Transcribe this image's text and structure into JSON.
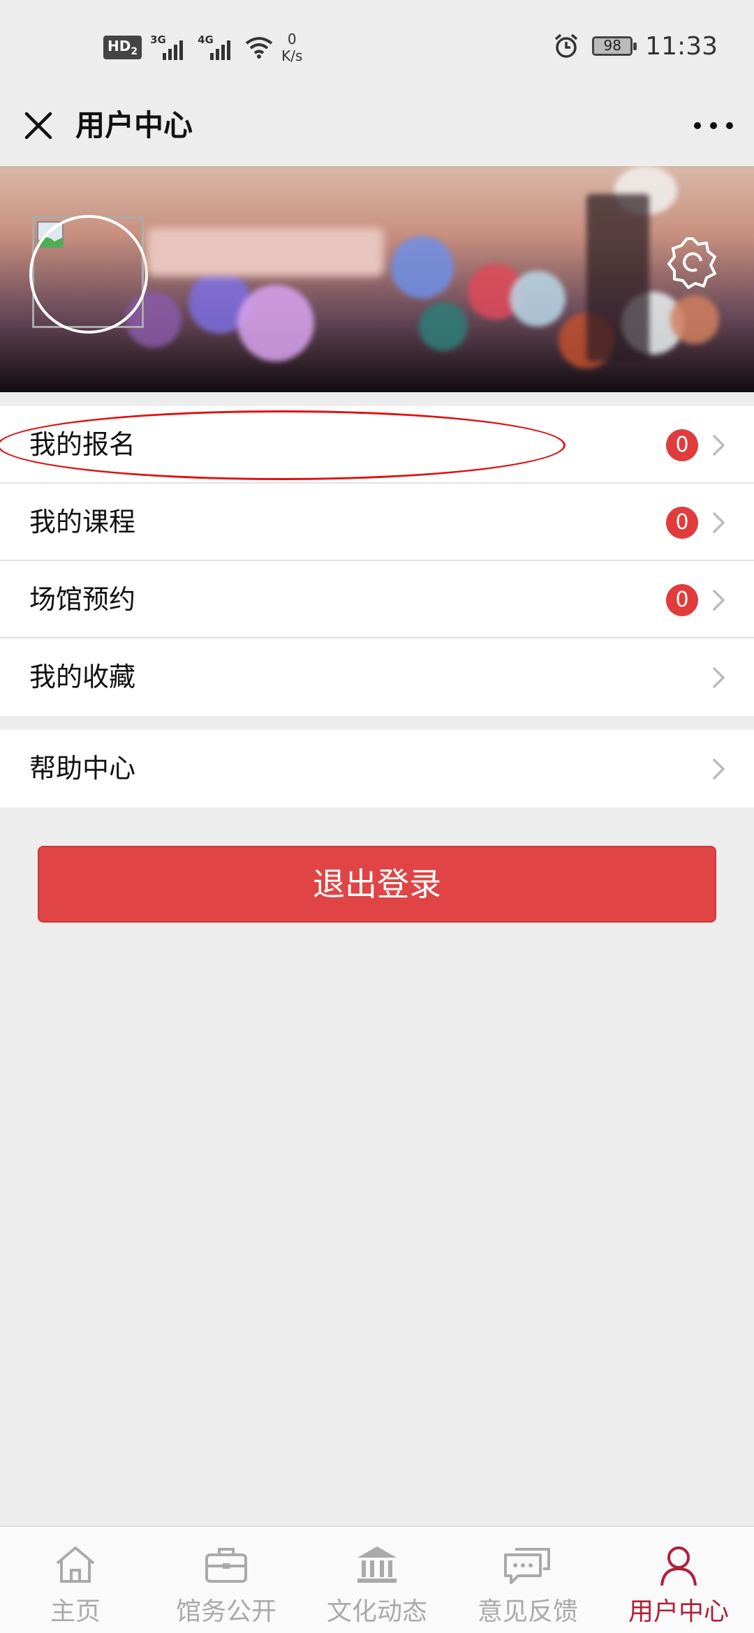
{
  "status_bar": {
    "hd_label": "HD",
    "hd_sub": "2",
    "net1": "3G",
    "net2": "4G",
    "speed_value": "0",
    "speed_unit": "K/s",
    "battery": "98",
    "time": "11:33"
  },
  "nav": {
    "title": "用户中心",
    "close_icon": "close-icon",
    "more_icon": "more-icon"
  },
  "banner": {
    "avatar_icon": "broken-image-icon",
    "settings_icon": "settings-icon"
  },
  "menu": {
    "group1": [
      {
        "label": "我的报名",
        "badge": "0"
      },
      {
        "label": "我的课程",
        "badge": "0"
      },
      {
        "label": "场馆预约",
        "badge": "0"
      },
      {
        "label": "我的收藏"
      }
    ],
    "group2": [
      {
        "label": "帮助中心"
      }
    ]
  },
  "logout_label": "退出登录",
  "tabs": [
    {
      "label": "主页",
      "icon": "home-icon"
    },
    {
      "label": "馆务公开",
      "icon": "briefcase-icon"
    },
    {
      "label": "文化动态",
      "icon": "museum-icon"
    },
    {
      "label": "意见反馈",
      "icon": "chat-icon"
    },
    {
      "label": "用户中心",
      "icon": "user-icon",
      "active": true
    }
  ],
  "colors": {
    "accent_red": "#e04444",
    "badge_red": "#e03c3c",
    "active_tab": "#b0203a",
    "annotation_red": "#e01010"
  }
}
